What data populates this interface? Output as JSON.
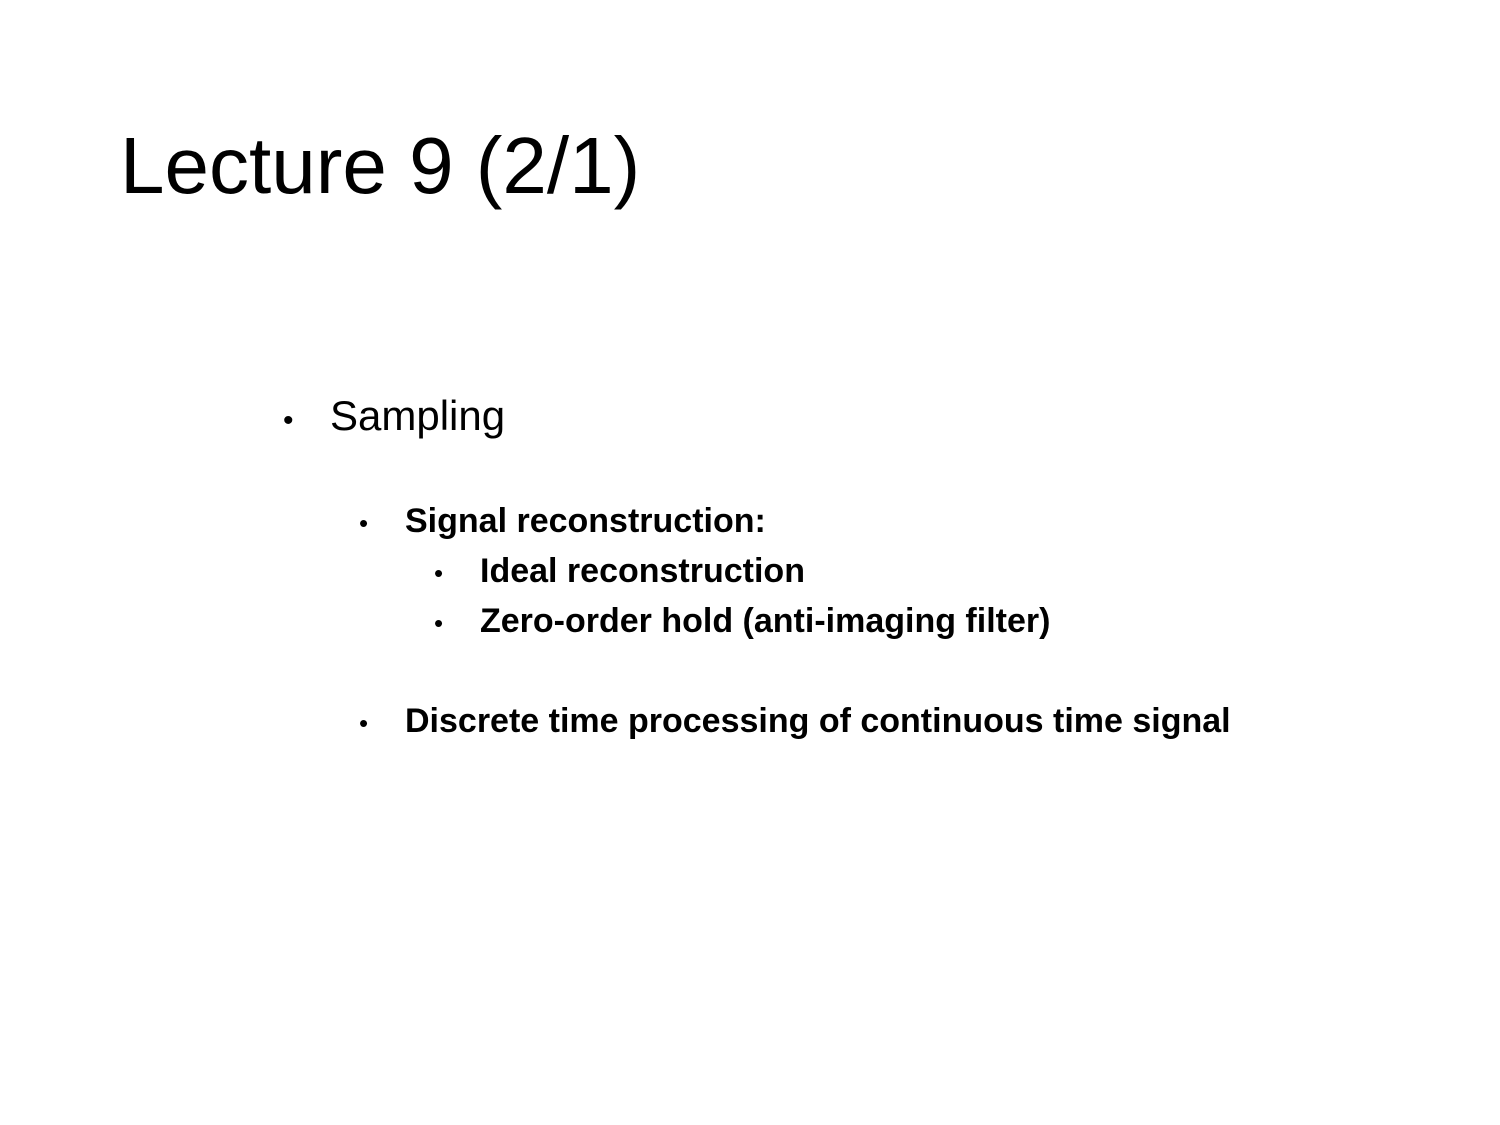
{
  "slide": {
    "title": "Lecture 9 (2/1)",
    "bullet_glyph": "•",
    "items": [
      {
        "label": "Sampling",
        "children": [
          {
            "label": "Signal reconstruction:",
            "children": [
              {
                "label": "Ideal reconstruction"
              },
              {
                "label": "Zero-order hold (anti-imaging filter)"
              }
            ]
          },
          {
            "label": "Discrete time processing of continuous time signal"
          }
        ]
      }
    ]
  }
}
